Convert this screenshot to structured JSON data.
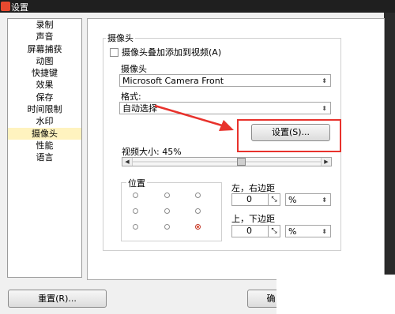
{
  "window": {
    "title": "设置"
  },
  "sidebar": {
    "items": [
      "录制",
      "声音",
      "屏幕捕获",
      "动图",
      "快捷键",
      "效果",
      "保存",
      "时间限制",
      "水印",
      "摄像头",
      "性能",
      "语言"
    ],
    "selected_index": 9
  },
  "camera_group": {
    "legend": "摄像头",
    "overlay_checkbox": {
      "label": "摄像头叠加添加到视频(A)",
      "checked": false
    },
    "camera_label": "摄像头",
    "camera_value": "Microsoft Camera Front",
    "format_label": "格式:",
    "format_value": "自动选择",
    "settings_button": "设置(S)...",
    "video_size_label": "视频大小: 45%",
    "video_size_percent": 45,
    "position_legend": "位置",
    "selected_position": "bottom-right",
    "lr_margin_label": "左，右边距",
    "lr_margin_value": "0",
    "lr_unit": "%",
    "tb_margin_label": "上，下边距",
    "tb_margin_value": "0",
    "tb_unit": "%"
  },
  "footer": {
    "reset_button": "重置(R)...",
    "ok_button": "确"
  },
  "colors": {
    "selection": "#fff3bf",
    "annotation_red": "#e8322c",
    "titlebar": "#1f1f1f"
  }
}
